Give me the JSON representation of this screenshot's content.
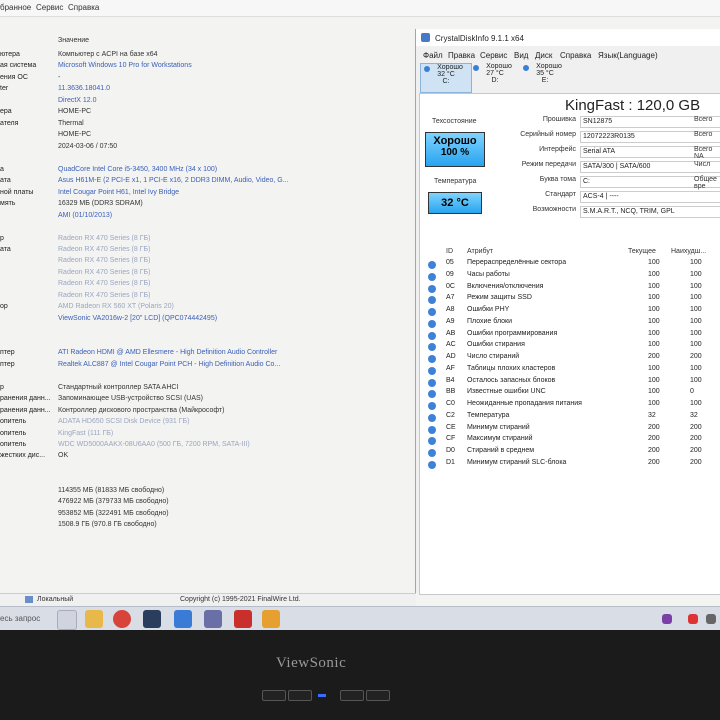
{
  "menubar": {
    "items": [
      "бранное",
      "Сервис",
      "Справка"
    ]
  },
  "left": {
    "col_header": "Значение",
    "rows": [
      {
        "label": "ютера",
        "value": "Компьютер с ACPI на базе x64",
        "style": "dark"
      },
      {
        "label": "ая система",
        "value": "Microsoft Windows 10 Pro for Workstations",
        "style": "blue"
      },
      {
        "label": "ения ОС",
        "value": "-",
        "style": "dark"
      },
      {
        "label": "ter",
        "value": "11.3636.18041.0",
        "style": "blue"
      },
      {
        "label": "",
        "value": "DirectX 12.0",
        "style": "blue"
      },
      {
        "label": "ера",
        "value": "HOME-PC",
        "style": "dark"
      },
      {
        "label": "ателя",
        "value": "Thermal",
        "style": "dark"
      },
      {
        "label": "",
        "value": "HOME-PC",
        "style": "dark"
      },
      {
        "label": "",
        "value": "2024-03-06 / 07:50",
        "style": "dark"
      },
      {
        "label": "",
        "value": "",
        "style": "dark"
      },
      {
        "label": "а",
        "value": "QuadCore Intel Core i5-3450, 3400 MHz (34 x 100)",
        "style": "blue"
      },
      {
        "label": "ата",
        "value": "Asus H61M-E  (2 PCI-E x1, 1 PCI-E x16, 2 DDR3 DIMM, Audio, Video, G...",
        "style": "blue"
      },
      {
        "label": "ной платы",
        "value": "Intel Cougar Point H61, Intel Ivy Bridge",
        "style": "blue"
      },
      {
        "label": "мять",
        "value": "16329 МБ  (DDR3 SDRAM)",
        "style": "dark"
      },
      {
        "label": "",
        "value": "AMI (01/10/2013)",
        "style": "blue"
      },
      {
        "label": "",
        "value": "",
        "style": "dark"
      },
      {
        "label": "р",
        "value": "Radeon RX 470 Series  (8 ГБ)",
        "style": "gray"
      },
      {
        "label": "ата",
        "value": "Radeon RX 470 Series  (8 ГБ)",
        "style": "gray"
      },
      {
        "label": "",
        "value": "Radeon RX 470 Series  (8 ГБ)",
        "style": "gray"
      },
      {
        "label": "",
        "value": "Radeon RX 470 Series  (8 ГБ)",
        "style": "gray"
      },
      {
        "label": "",
        "value": "Radeon RX 470 Series  (8 ГБ)",
        "style": "gray"
      },
      {
        "label": "",
        "value": "Radeon RX 470 Series  (8 ГБ)",
        "style": "gray"
      },
      {
        "label": "ор",
        "value": "AMD Radeon RX 560 XT (Polaris 20)",
        "style": "gray"
      },
      {
        "label": "",
        "value": "ViewSonic VA2016w-2  [20\" LCD]  (QPC074442495)",
        "style": "blue"
      },
      {
        "label": "",
        "value": "",
        "style": "dark"
      },
      {
        "label": "",
        "value": "",
        "style": "dark"
      },
      {
        "label": "птер",
        "value": "ATI Radeon HDMI @ AMD Ellesmere - High Definition Audio Controller",
        "style": "blue"
      },
      {
        "label": "птер",
        "value": "Realtek ALC887 @ Intel Cougar Point PCH - High Definition Audio Co...",
        "style": "blue"
      },
      {
        "label": "",
        "value": "",
        "style": "dark"
      },
      {
        "label": "р",
        "value": "Стандартный контроллер SATA AHCI",
        "style": "dark"
      },
      {
        "label": "ранения данн...",
        "value": "Запоминающее USB-устройство SCSI (UAS)",
        "style": "dark"
      },
      {
        "label": "ранения данн...",
        "value": "Контроллер дискового пространства (Майкрософт)",
        "style": "dark"
      },
      {
        "label": "опитель",
        "value": "ADATA HD650 SCSI Disk Device  (931 ГБ)",
        "style": "gray"
      },
      {
        "label": "опитель",
        "value": "KingFast  (111 ГБ)",
        "style": "gray"
      },
      {
        "label": "опитель",
        "value": "WDC WD5000AAKX-08U6AA0  (500 ГБ, 7200 RPM, SATA-III)",
        "style": "gray"
      },
      {
        "label": "жестких дис...",
        "value": "OK",
        "style": "dark"
      },
      {
        "label": "",
        "value": "",
        "style": "dark"
      },
      {
        "label": "",
        "value": "",
        "style": "dark"
      },
      {
        "label": "",
        "value": "114355 МБ (81833 МБ свободно)",
        "style": "dark"
      },
      {
        "label": "",
        "value": "476922 МБ (379733 МБ свободно)",
        "style": "dark"
      },
      {
        "label": "",
        "value": "953852 МБ (322491 МБ свободно)",
        "style": "dark"
      },
      {
        "label": "",
        "value": "1508.9 ГБ (970.8 ГБ свободно)",
        "style": "dark"
      }
    ],
    "status_left": "Локальный",
    "status_copyright": "Copyright (c) 1995-2021 FinalWire Ltd."
  },
  "taskbar": {
    "search": "есь запрос",
    "tray": ""
  },
  "cdi": {
    "title": "CrystalDiskInfo 9.1.1 x64",
    "menu": [
      "Файл",
      "Правка",
      "Сервис",
      "Вид",
      "Диск",
      "Справка",
      "Язык(Language)"
    ],
    "disks": [
      {
        "status": "Хорошо",
        "temp": "32 °C",
        "letter": "C:"
      },
      {
        "status": "Хорошо",
        "temp": "27 °C",
        "letter": "D:"
      },
      {
        "status": "Хорошо",
        "temp": "35 °C",
        "letter": "E:"
      }
    ],
    "model": "KingFast : 120,0 GB",
    "labels": {
      "health": "Техсостояние",
      "temperature": "Температура"
    },
    "health_status": "Хорошо",
    "health_percent": "100 %",
    "temperature": "32 °C",
    "info": [
      {
        "k": "Прошивка",
        "v": "SN12875",
        "r": "Всего"
      },
      {
        "k": "Серийный номер",
        "v": "12072223R0135",
        "r": "Всего"
      },
      {
        "k": "Интерфейс",
        "v": "Serial ATA",
        "r": "Всего NA"
      },
      {
        "k": "Режим передачи",
        "v": "SATA/300 | SATA/600",
        "r": "Числ"
      },
      {
        "k": "Буква тома",
        "v": "C:",
        "r": "Общее вре"
      },
      {
        "k": "Стандарт",
        "v": "ACS-4 | ----",
        "r": ""
      },
      {
        "k": "Возможности",
        "v": "S.M.A.R.T., NCQ, TRIM, GPL",
        "r": ""
      }
    ],
    "smart_header": {
      "id": "ID",
      "attr": "Атрибут",
      "cur": "Текущее",
      "worst": "Наихудш..."
    },
    "smart": [
      {
        "id": "05",
        "name": "Перераспределённые сектора",
        "cur": "100",
        "worst": "100"
      },
      {
        "id": "09",
        "name": "Часы работы",
        "cur": "100",
        "worst": "100"
      },
      {
        "id": "0C",
        "name": "Включения/отключения",
        "cur": "100",
        "worst": "100"
      },
      {
        "id": "A7",
        "name": "Режим защиты SSD",
        "cur": "100",
        "worst": "100"
      },
      {
        "id": "A8",
        "name": "Ошибки PHY",
        "cur": "100",
        "worst": "100"
      },
      {
        "id": "A9",
        "name": "Плохие блоки",
        "cur": "100",
        "worst": "100"
      },
      {
        "id": "AB",
        "name": "Ошибки программирования",
        "cur": "100",
        "worst": "100"
      },
      {
        "id": "AC",
        "name": "Ошибки стирания",
        "cur": "100",
        "worst": "100"
      },
      {
        "id": "AD",
        "name": "Число стираний",
        "cur": "200",
        "worst": "200"
      },
      {
        "id": "AF",
        "name": "Таблицы плохих кластеров",
        "cur": "100",
        "worst": "100"
      },
      {
        "id": "B4",
        "name": "Осталось запасных блоков",
        "cur": "100",
        "worst": "100"
      },
      {
        "id": "BB",
        "name": "Известные ошибки UNC",
        "cur": "100",
        "worst": "0"
      },
      {
        "id": "C0",
        "name": "Неожиданные пропадания питания",
        "cur": "100",
        "worst": "100"
      },
      {
        "id": "C2",
        "name": "Температура",
        "cur": "32",
        "worst": "32"
      },
      {
        "id": "CE",
        "name": "Минимум стираний",
        "cur": "200",
        "worst": "200"
      },
      {
        "id": "CF",
        "name": "Максимум стираний",
        "cur": "200",
        "worst": "200"
      },
      {
        "id": "D0",
        "name": "Стираний в среднем",
        "cur": "200",
        "worst": "200"
      },
      {
        "id": "D1",
        "name": "Минимум стираний SLC-блока",
        "cur": "200",
        "worst": "200"
      }
    ]
  },
  "monitor": {
    "brand": "ViewSonic"
  },
  "colors": {
    "good": "#27a4ef",
    "link": "#3a5fb8"
  }
}
